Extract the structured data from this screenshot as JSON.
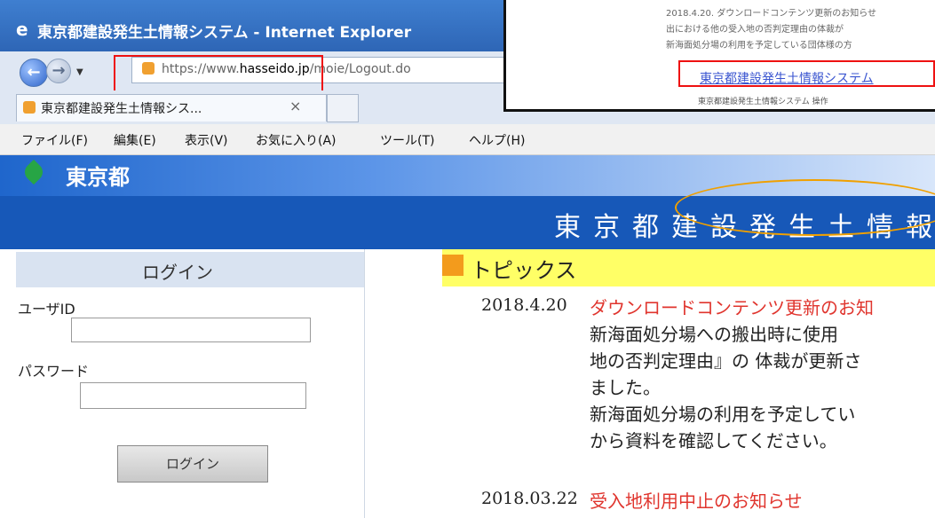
{
  "window": {
    "title": "東京都建設発生土情報システム - Internet Explorer"
  },
  "address": {
    "prefix": "https://www.",
    "domain": "hasseido.jp",
    "path": "/moie/Logout.do"
  },
  "tab": {
    "label": "東京都建設発生土情報シス...",
    "close": "×"
  },
  "menu": [
    "ファイル(F)",
    "編集(E)",
    "表示(V)",
    "お気に入り(A)",
    "ツール(T)",
    "ヘルプ(H)"
  ],
  "header": {
    "org": "東京都",
    "system_title": "東京都建設発生土情報"
  },
  "login": {
    "title": "ログイン",
    "user_id_label": "ユーザID",
    "user_id_value": "",
    "password_label": "パスワード",
    "password_value": "",
    "button": "ログイン"
  },
  "topics": {
    "title": "トピックス",
    "items": [
      {
        "date": "2018.4.20",
        "headline": "ダウンロードコンテンツ更新のお知",
        "body": [
          "新海面処分場への搬出時に使用",
          "地の否判定理由』の 体裁が更新さ",
          "ました。",
          "新海面処分場の利用を予定してい",
          "から資料を確認してください。"
        ]
      },
      {
        "date": "2018.03.22",
        "headline": "受入地利用中止のお知らせ",
        "body": []
      }
    ]
  },
  "inset": {
    "lines": [
      "2018.4.20. ダウンロードコンテンツ更新のお知らせ",
      "出における他の受入地の否判定理由の体裁が",
      "新海面処分場の利用を予定している団体様の方"
    ],
    "link": "東京都建設発生土情報システム",
    "caption": "東京都建設発生土情報システム 操作"
  },
  "colors": {
    "tokyo_blue": "#1758b8",
    "topics_yellow": "#ffff66",
    "headline_red": "#e0352e",
    "highlight_red": "#e11111",
    "ellipse_orange": "#f0a000"
  }
}
